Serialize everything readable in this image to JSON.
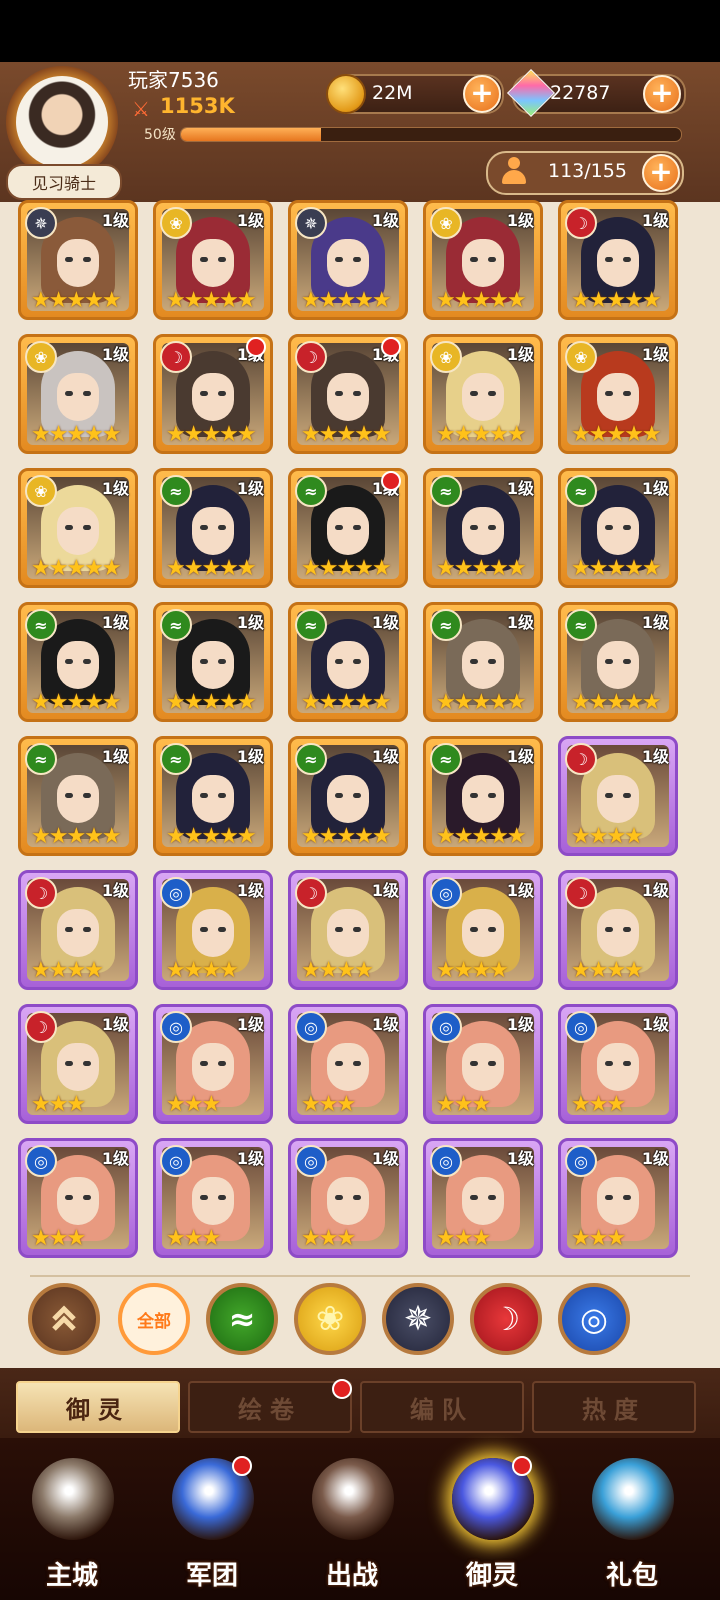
{
  "player": {
    "name": "玩家7536",
    "power": "1153K",
    "level": "50级",
    "xp_progress": 0.28,
    "rank_title": "见习骑士"
  },
  "resources": {
    "coins": "22M",
    "gems": "22787",
    "roster": "113/155"
  },
  "cards": [
    {
      "element": "dark",
      "lvl": "1级",
      "stars": "★★★★★",
      "frame": "gold",
      "dot": false,
      "hair": "#8a5a3a"
    },
    {
      "element": "light",
      "lvl": "1级",
      "stars": "★★★★★",
      "frame": "gold",
      "dot": false,
      "hair": "#9a2b35"
    },
    {
      "element": "dark",
      "lvl": "1级",
      "stars": "★★★★★",
      "frame": "gold",
      "dot": false,
      "hair": "#4a3a8a"
    },
    {
      "element": "light",
      "lvl": "1级",
      "stars": "★★★★★",
      "frame": "gold",
      "dot": false,
      "hair": "#9a2b35"
    },
    {
      "element": "fire",
      "lvl": "1级",
      "stars": "★★★★★",
      "frame": "gold",
      "dot": false,
      "hair": "#22223a"
    },
    {
      "element": "light",
      "lvl": "1级",
      "stars": "★★★★★",
      "frame": "gold",
      "dot": false,
      "hair": "#c9c3c0"
    },
    {
      "element": "fire",
      "lvl": "1级",
      "stars": "★★★★★",
      "frame": "gold",
      "dot": true,
      "hair": "#4a3a30"
    },
    {
      "element": "fire",
      "lvl": "1级",
      "stars": "★★★★★",
      "frame": "gold",
      "dot": true,
      "hair": "#4a3a30"
    },
    {
      "element": "light",
      "lvl": "1级",
      "stars": "★★★★★",
      "frame": "gold",
      "dot": false,
      "hair": "#e7d08a"
    },
    {
      "element": "light",
      "lvl": "1级",
      "stars": "★★★★★",
      "frame": "gold",
      "dot": false,
      "hair": "#b83a1e"
    },
    {
      "element": "light",
      "lvl": "1级",
      "stars": "★★★★★",
      "frame": "gold",
      "dot": false,
      "hair": "#ecd99a"
    },
    {
      "element": "wind",
      "lvl": "1级",
      "stars": "★★★★★",
      "frame": "gold",
      "dot": false,
      "hair": "#22223a"
    },
    {
      "element": "wind",
      "lvl": "1级",
      "stars": "★★★★★",
      "frame": "gold",
      "dot": true,
      "hair": "#1a1a1a"
    },
    {
      "element": "wind",
      "lvl": "1级",
      "stars": "★★★★★",
      "frame": "gold",
      "dot": false,
      "hair": "#22223a"
    },
    {
      "element": "wind",
      "lvl": "1级",
      "stars": "★★★★★",
      "frame": "gold",
      "dot": false,
      "hair": "#22223a"
    },
    {
      "element": "wind",
      "lvl": "1级",
      "stars": "★★★★★",
      "frame": "gold",
      "dot": false,
      "hair": "#1a1a1a"
    },
    {
      "element": "wind",
      "lvl": "1级",
      "stars": "★★★★★",
      "frame": "gold",
      "dot": false,
      "hair": "#1a1a1a"
    },
    {
      "element": "wind",
      "lvl": "1级",
      "stars": "★★★★★",
      "frame": "gold",
      "dot": false,
      "hair": "#22223a"
    },
    {
      "element": "wind",
      "lvl": "1级",
      "stars": "★★★★★",
      "frame": "gold",
      "dot": false,
      "hair": "#7a6a58"
    },
    {
      "element": "wind",
      "lvl": "1级",
      "stars": "★★★★★",
      "frame": "gold",
      "dot": false,
      "hair": "#7a6a58"
    },
    {
      "element": "wind",
      "lvl": "1级",
      "stars": "★★★★★",
      "frame": "gold",
      "dot": false,
      "hair": "#7a6a58"
    },
    {
      "element": "wind",
      "lvl": "1级",
      "stars": "★★★★★",
      "frame": "gold",
      "dot": false,
      "hair": "#22223a"
    },
    {
      "element": "wind",
      "lvl": "1级",
      "stars": "★★★★★",
      "frame": "gold",
      "dot": false,
      "hair": "#22223a"
    },
    {
      "element": "wind",
      "lvl": "1级",
      "stars": "★★★★★",
      "frame": "gold",
      "dot": false,
      "hair": "#2a1a2a"
    },
    {
      "element": "fire",
      "lvl": "1级",
      "stars": "★★★★",
      "frame": "purple",
      "dot": false,
      "hair": "#d9c07a"
    },
    {
      "element": "fire",
      "lvl": "1级",
      "stars": "★★★★",
      "frame": "purple",
      "dot": false,
      "hair": "#d9c07a"
    },
    {
      "element": "water",
      "lvl": "1级",
      "stars": "★★★★",
      "frame": "purple",
      "dot": false,
      "hair": "#d9b04a"
    },
    {
      "element": "fire",
      "lvl": "1级",
      "stars": "★★★★",
      "frame": "purple",
      "dot": false,
      "hair": "#d9c07a"
    },
    {
      "element": "water",
      "lvl": "1级",
      "stars": "★★★★",
      "frame": "purple",
      "dot": false,
      "hair": "#d9b04a"
    },
    {
      "element": "fire",
      "lvl": "1级",
      "stars": "★★★★",
      "frame": "purple",
      "dot": false,
      "hair": "#d9c07a"
    },
    {
      "element": "fire",
      "lvl": "1级",
      "stars": "★★★",
      "frame": "purple",
      "dot": false,
      "hair": "#d9c07a"
    },
    {
      "element": "water",
      "lvl": "1级",
      "stars": "★★★",
      "frame": "purple",
      "dot": false,
      "hair": "#e89a80"
    },
    {
      "element": "water",
      "lvl": "1级",
      "stars": "★★★",
      "frame": "purple",
      "dot": false,
      "hair": "#e89a80"
    },
    {
      "element": "water",
      "lvl": "1级",
      "stars": "★★★",
      "frame": "purple",
      "dot": false,
      "hair": "#e89a80"
    },
    {
      "element": "water",
      "lvl": "1级",
      "stars": "★★★",
      "frame": "purple",
      "dot": false,
      "hair": "#e89a80"
    },
    {
      "element": "water",
      "lvl": "1级",
      "stars": "★★★",
      "frame": "purple",
      "dot": false,
      "hair": "#e89a80"
    },
    {
      "element": "water",
      "lvl": "1级",
      "stars": "★★★",
      "frame": "purple",
      "dot": false,
      "hair": "#e89a80"
    },
    {
      "element": "water",
      "lvl": "1级",
      "stars": "★★★",
      "frame": "purple",
      "dot": false,
      "hair": "#e89a80"
    },
    {
      "element": "water",
      "lvl": "1级",
      "stars": "★★★",
      "frame": "purple",
      "dot": false,
      "hair": "#e89a80"
    },
    {
      "element": "water",
      "lvl": "1级",
      "stars": "★★★",
      "frame": "purple",
      "dot": false,
      "hair": "#e89a80"
    }
  ],
  "element_colors": {
    "dark": "#3a3d52",
    "light": "#e8b625",
    "fire": "#c8222a",
    "wind": "#2f8a1e",
    "water": "#1e5ec8"
  },
  "element_glyphs": {
    "dark": "✵",
    "light": "❀",
    "fire": "☽",
    "wind": "≈",
    "water": "◎"
  },
  "filters": {
    "collapse_icon": "chevrons-up-icon",
    "all_label": "全部",
    "elements": [
      "wind",
      "light",
      "dark",
      "fire",
      "water"
    ]
  },
  "subtabs": [
    {
      "label": "御灵",
      "active": true,
      "dot": false
    },
    {
      "label": "绘卷",
      "active": false,
      "dot": true
    },
    {
      "label": "编队",
      "active": false,
      "dot": false
    },
    {
      "label": "热度",
      "active": false,
      "dot": false
    }
  ],
  "nav": [
    {
      "label": "主城",
      "icon": "castle-icon",
      "color": "#8c7a6a",
      "dot": false
    },
    {
      "label": "军团",
      "icon": "legion-fist-icon",
      "color": "#3a6ad8",
      "dot": true
    },
    {
      "label": "出战",
      "icon": "battle-gate-icon",
      "color": "#7a5a4a",
      "dot": false
    },
    {
      "label": "御灵",
      "icon": "spirit-crystal-icon",
      "color": "#4a58e0",
      "dot": true,
      "active": true
    },
    {
      "label": "礼包",
      "icon": "gift-shop-icon",
      "color": "#3aa0d8",
      "dot": false
    }
  ]
}
